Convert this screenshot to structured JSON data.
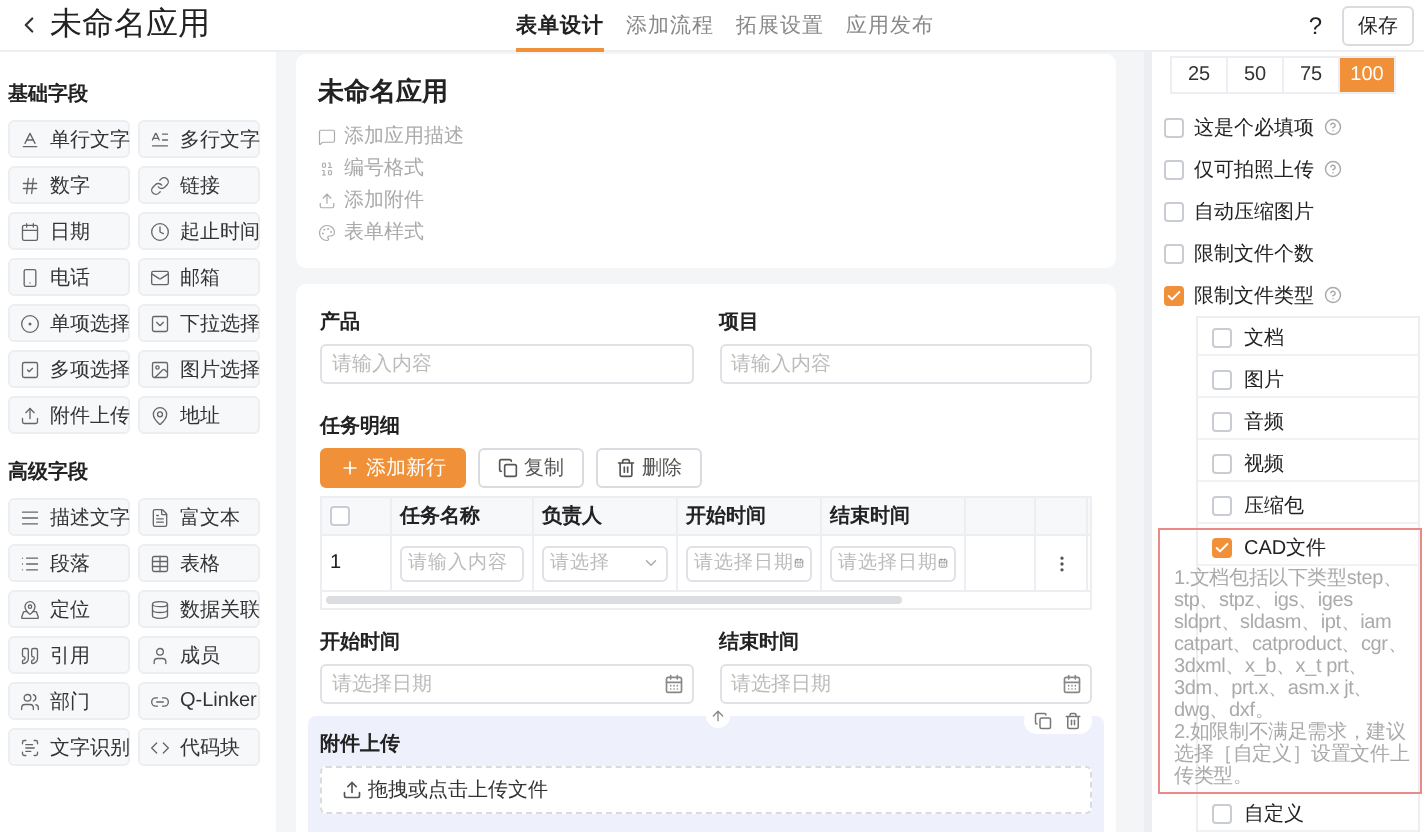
{
  "header": {
    "title": "未命名应用",
    "tabs": [
      {
        "label": "表单设计",
        "selected": true
      },
      {
        "label": "添加流程",
        "selected": false
      },
      {
        "label": "拓展设置",
        "selected": false
      },
      {
        "label": "应用发布",
        "selected": false
      }
    ],
    "help": "?",
    "save_button": "保存"
  },
  "sidebar": {
    "sections": [
      {
        "title": "基础字段",
        "items": [
          {
            "label": "单行文字"
          },
          {
            "label": "多行文字"
          },
          {
            "label": "数字"
          },
          {
            "label": "链接"
          },
          {
            "label": "日期"
          },
          {
            "label": "起止时间"
          },
          {
            "label": "电话"
          },
          {
            "label": "邮箱"
          },
          {
            "label": "单项选择"
          },
          {
            "label": "下拉选择"
          },
          {
            "label": "多项选择"
          },
          {
            "label": "图片选择"
          },
          {
            "label": "附件上传"
          },
          {
            "label": "地址"
          }
        ]
      },
      {
        "title": "高级字段",
        "items": [
          {
            "label": "描述文字"
          },
          {
            "label": "富文本"
          },
          {
            "label": "段落"
          },
          {
            "label": "表格"
          },
          {
            "label": "定位"
          },
          {
            "label": "数据关联"
          },
          {
            "label": "引用"
          },
          {
            "label": "成员"
          },
          {
            "label": "部门"
          },
          {
            "label": "Q-Linker"
          },
          {
            "label": "文字识别"
          },
          {
            "label": "代码块"
          }
        ]
      }
    ]
  },
  "app_card": {
    "title": "未命名应用",
    "actions": [
      {
        "label": "添加应用描述"
      },
      {
        "label": "编号格式"
      },
      {
        "label": "添加附件"
      },
      {
        "label": "表单样式"
      }
    ]
  },
  "form": {
    "top_fields": [
      {
        "label": "产品",
        "placeholder": "请输入内容"
      },
      {
        "label": "项目",
        "placeholder": "请输入内容"
      }
    ],
    "subtable": {
      "title": "任务明细",
      "buttons": [
        {
          "label": "添加新行",
          "kind": "add"
        },
        {
          "label": "复制",
          "kind": "copy"
        },
        {
          "label": "删除",
          "kind": "delete"
        }
      ],
      "columns": [
        {
          "kind": "select",
          "checked": false
        },
        {
          "kind": "text",
          "label": "任务名称"
        },
        {
          "kind": "text",
          "label": "负责人"
        },
        {
          "kind": "text",
          "label": "开始时间"
        },
        {
          "kind": "text",
          "label": "结束时间"
        },
        {
          "kind": "blank"
        },
        {
          "kind": "blank"
        }
      ],
      "rows": [
        {
          "cells": [
            {
              "kind": "index",
              "text": "1"
            },
            {
              "kind": "input",
              "placeholder": "请输入内容"
            },
            {
              "kind": "select",
              "placeholder": "请选择"
            },
            {
              "kind": "date",
              "placeholder": "请选择日期"
            },
            {
              "kind": "date",
              "placeholder": "请选择日期"
            },
            {
              "kind": "blank"
            },
            {
              "kind": "menu"
            }
          ]
        }
      ]
    },
    "date_fields": [
      {
        "label": "开始时间",
        "placeholder": "请选择日期"
      },
      {
        "label": "结束时间",
        "placeholder": "请选择日期"
      }
    ],
    "upload": {
      "label": "附件上传",
      "hint": "拖拽或点击上传文件",
      "selected": true
    }
  },
  "settings": {
    "width_options": [
      {
        "label": "25",
        "selected": false
      },
      {
        "label": "50",
        "selected": false
      },
      {
        "label": "75",
        "selected": false
      },
      {
        "label": "100",
        "selected": true
      }
    ],
    "options": [
      {
        "label": "这是个必填项",
        "checked": false,
        "help": true
      },
      {
        "label": "仅可拍照上传",
        "checked": false,
        "help": true
      },
      {
        "label": "自动压缩图片",
        "checked": false,
        "help": false
      },
      {
        "label": "限制文件个数",
        "checked": false,
        "help": false
      },
      {
        "label": "限制文件类型",
        "checked": true,
        "help": true
      }
    ],
    "file_types": [
      {
        "label": "文档",
        "checked": false,
        "highlighted": false
      },
      {
        "label": "图片",
        "checked": false,
        "highlighted": false
      },
      {
        "label": "音频",
        "checked": false,
        "highlighted": false
      },
      {
        "label": "视频",
        "checked": false,
        "highlighted": false
      },
      {
        "label": "压缩包",
        "checked": false,
        "highlighted": false
      },
      {
        "label": "CAD文件",
        "checked": true,
        "highlighted": true,
        "description": [
          "1.文档包括以下类型step、stp、stpz、igs、iges sldprt、sldasm、ipt、iam catpart、catproduct、cgr、3dxml、x_b、x_t prt、3dm、prt.x、asm.x jt、dwg、dxf。",
          "2.如限制不满足需求，建议选择［自定义］设置文件上传类型。"
        ]
      },
      {
        "label": "自定义",
        "checked": false,
        "highlighted": false
      }
    ]
  }
}
